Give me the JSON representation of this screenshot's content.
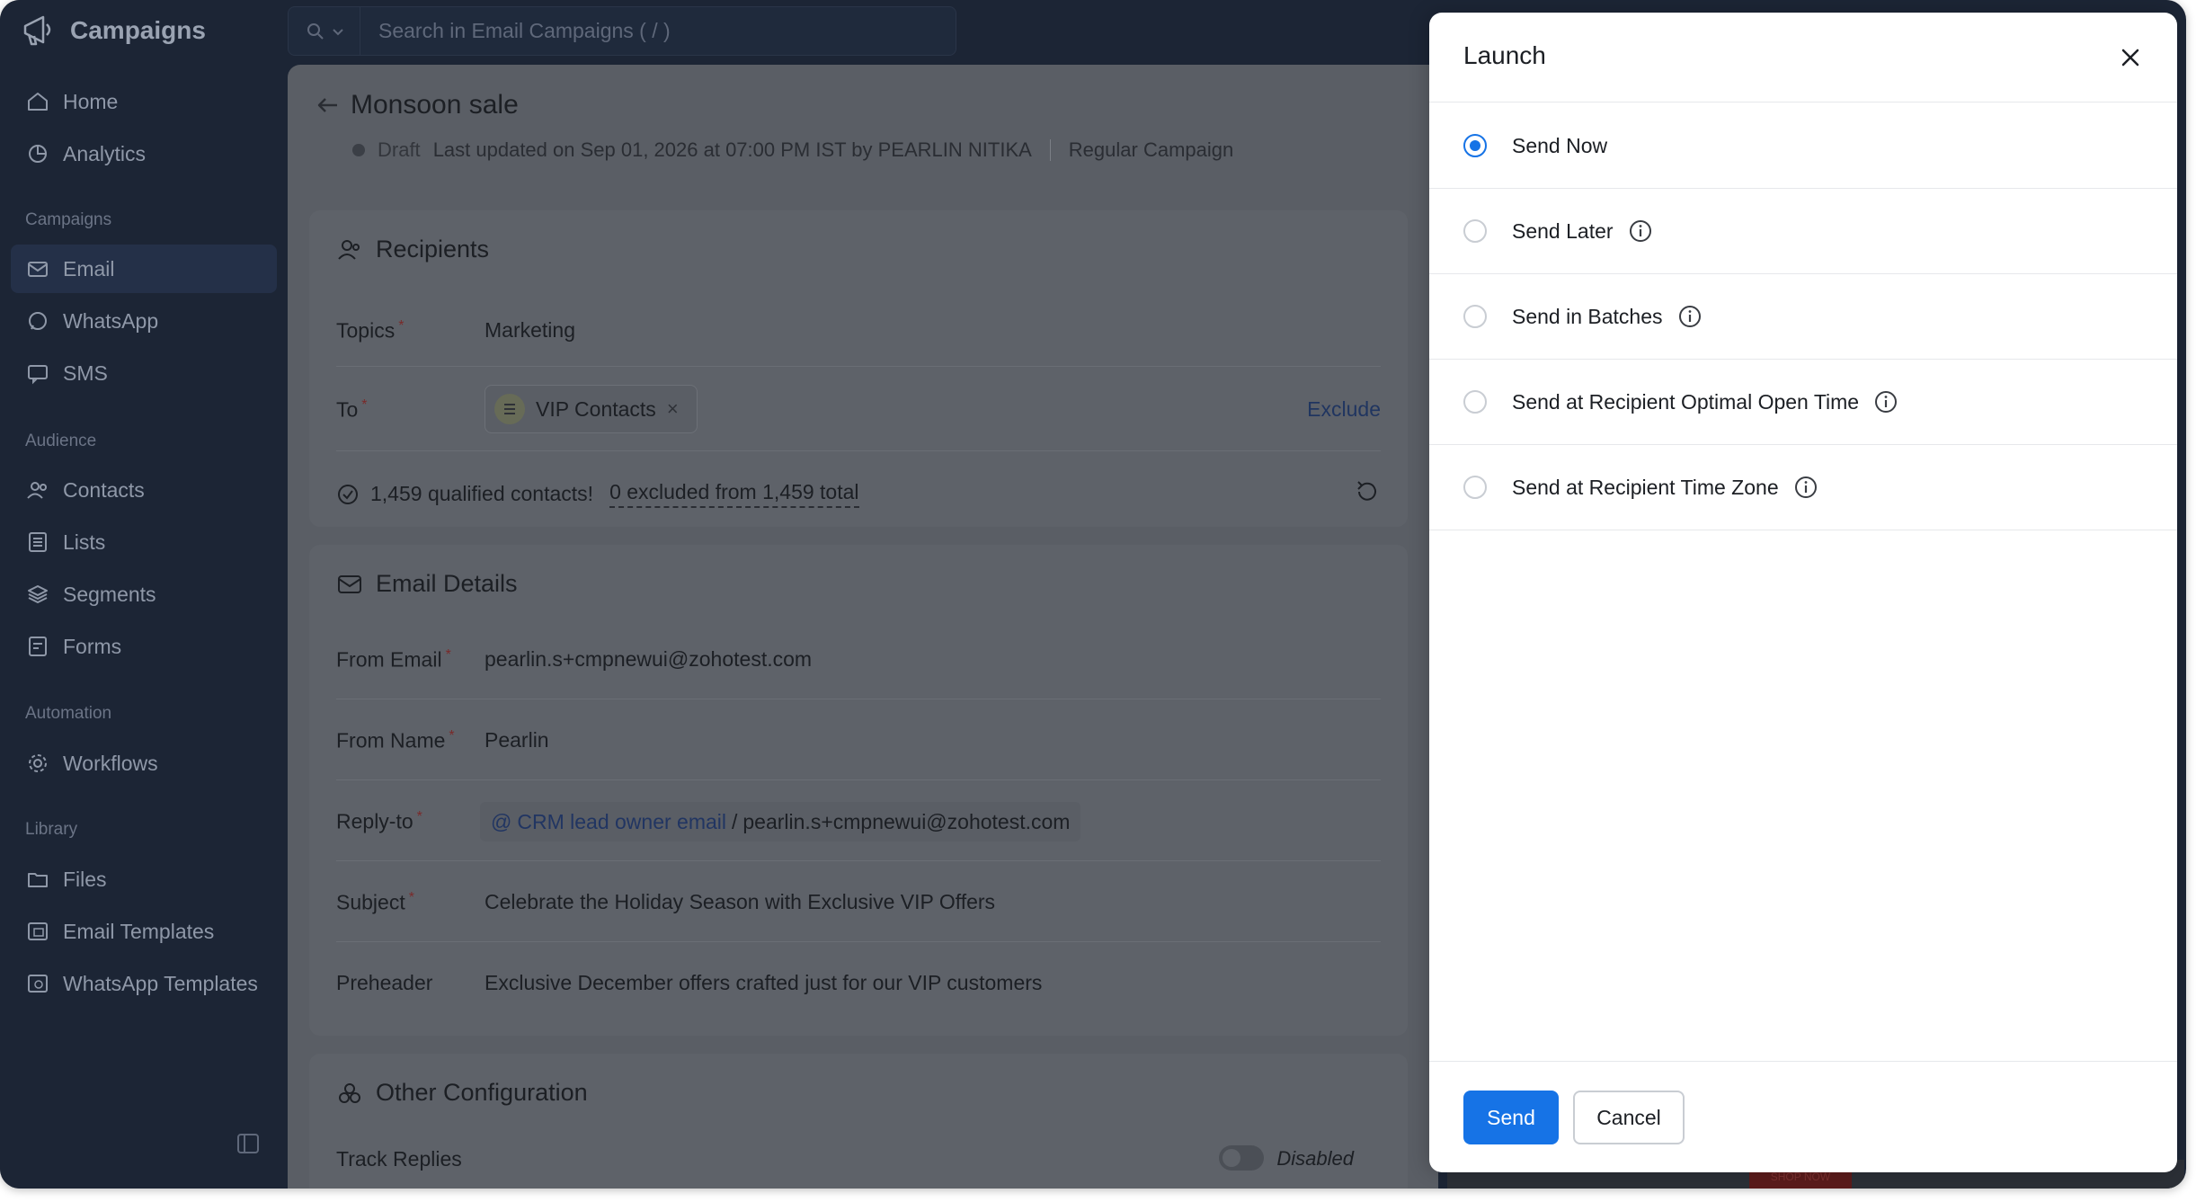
{
  "app": {
    "name": "Campaigns"
  },
  "search": {
    "placeholder": "Search in Email Campaigns ( / )"
  },
  "sidebar": {
    "top_items": [
      {
        "label": "Home",
        "icon": "home-icon"
      },
      {
        "label": "Analytics",
        "icon": "analytics-icon"
      }
    ],
    "groups": [
      {
        "title": "Campaigns",
        "items": [
          {
            "label": "Email",
            "icon": "email-icon",
            "active": true
          },
          {
            "label": "WhatsApp",
            "icon": "whatsapp-icon"
          },
          {
            "label": "SMS",
            "icon": "sms-icon"
          }
        ]
      },
      {
        "title": "Audience",
        "items": [
          {
            "label": "Contacts",
            "icon": "contacts-icon"
          },
          {
            "label": "Lists",
            "icon": "lists-icon"
          },
          {
            "label": "Segments",
            "icon": "segments-icon"
          },
          {
            "label": "Forms",
            "icon": "forms-icon"
          }
        ]
      },
      {
        "title": "Automation",
        "items": [
          {
            "label": "Workflows",
            "icon": "workflows-icon"
          }
        ]
      },
      {
        "title": "Library",
        "items": [
          {
            "label": "Files",
            "icon": "files-icon"
          },
          {
            "label": "Email Templates",
            "icon": "email-templates-icon"
          },
          {
            "label": "WhatsApp Templates",
            "icon": "whatsapp-templates-icon"
          }
        ]
      }
    ]
  },
  "campaign": {
    "title": "Monsoon sale",
    "status": "Draft",
    "last_updated": "Last updated on Sep 01, 2026 at 07:00 PM IST by PEARLIN NITIKA",
    "type": "Regular Campaign"
  },
  "recipients": {
    "title": "Recipients",
    "topics_label": "Topics",
    "topics_value": "Marketing",
    "to_label": "To",
    "to_chip": "VIP Contacts",
    "exclude_label": "Exclude",
    "qualified_text": "1,459 qualified contacts!",
    "excluded_text": "0 excluded from 1,459 total"
  },
  "email_details": {
    "title": "Email Details",
    "from_email_label": "From Email",
    "from_email_value": "pearlin.s+cmpnewui@zohotest.com",
    "from_name_label": "From Name",
    "from_name_value": "Pearlin",
    "reply_to_label": "Reply-to",
    "reply_to_at": "@",
    "reply_to_link": "CRM lead owner email",
    "reply_to_sep": "/",
    "reply_to_value": "pearlin.s+cmpnewui@zohotest.com",
    "subject_label": "Subject",
    "subject_value": "Celebrate the Holiday Season with Exclusive VIP Offers",
    "preheader_label": "Preheader",
    "preheader_value": "Exclusive December offers crafted just for our VIP customers"
  },
  "other_config": {
    "title": "Other Configuration",
    "track_replies_label": "Track Replies",
    "track_replies_state": "Disabled"
  },
  "preview": {
    "shop_now": "SHOP NOW"
  },
  "launch_modal": {
    "title": "Launch",
    "options": [
      {
        "label": "Send Now",
        "checked": true,
        "info": false
      },
      {
        "label": "Send Later",
        "checked": false,
        "info": true
      },
      {
        "label": "Send in Batches",
        "checked": false,
        "info": true
      },
      {
        "label": "Send at Recipient Optimal Open Time",
        "checked": false,
        "info": true
      },
      {
        "label": "Send at Recipient Time Zone",
        "checked": false,
        "info": true
      }
    ],
    "send_label": "Send",
    "cancel_label": "Cancel"
  },
  "colors": {
    "primary": "#1673e6",
    "sidebar_bg": "#1c2535",
    "overlay": "#5a5e65"
  }
}
